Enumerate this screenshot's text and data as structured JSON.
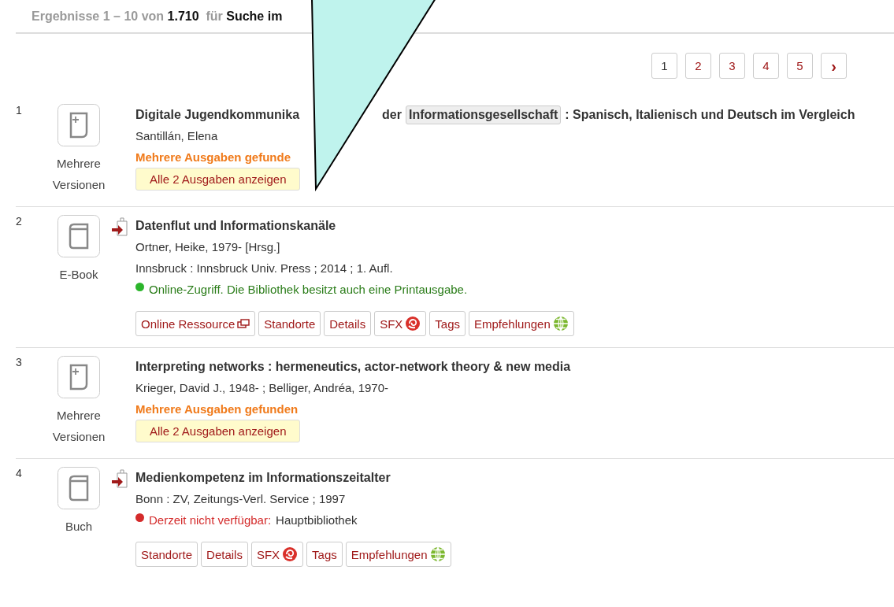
{
  "results_header": {
    "range": "Ergebnisse 1 – 10 von",
    "total": "1.710",
    "for": "für",
    "query": "Suche im"
  },
  "pagination": {
    "pages": [
      {
        "label": "1",
        "selected": true
      },
      {
        "label": "2",
        "selected": false
      },
      {
        "label": "3",
        "selected": false
      },
      {
        "label": "4",
        "selected": false
      },
      {
        "label": "5",
        "selected": false
      }
    ],
    "next": "›"
  },
  "results": [
    {
      "number": "1",
      "kind": "multi",
      "type_label": [
        "Mehrere",
        "Versionen"
      ],
      "access_icon": false,
      "title_parts": [
        {
          "text": "Digitale Jugendkommunika",
          "kind": "plain"
        },
        {
          "text": "der",
          "kind": "plain"
        },
        {
          "text": "Informationsgesellschaft",
          "kind": "highlight"
        },
        {
          "text": ": Spanisch, Italienisch und Deutsch im Vergleich",
          "kind": "plain"
        }
      ],
      "lines": [
        "Santillán, Elena"
      ],
      "editions_note": "Mehrere Ausgaben gefunde",
      "editions_button": "Alle 2 Ausgaben anzeigen"
    },
    {
      "number": "2",
      "kind": "book",
      "type_label": [
        "E-Book"
      ],
      "access_icon": true,
      "title_parts": [
        {
          "text": "Datenflut und Informationskanäle",
          "kind": "plain"
        }
      ],
      "lines": [
        "Ortner, Heike, 1979- [Hrsg.]",
        "Innsbruck : Innsbruck Univ. Press ; 2014 ; 1. Aufl."
      ],
      "status": {
        "kind": "online",
        "label": "Online-Zugriff. Die Bibliothek besitzt auch eine Printausgabe."
      },
      "actions": [
        {
          "label": "Online Ressource",
          "kind": "external"
        },
        {
          "label": "Standorte",
          "kind": "plain"
        },
        {
          "label": "Details",
          "kind": "plain"
        },
        {
          "label": "SFX",
          "kind": "sfx"
        },
        {
          "label": "Tags",
          "kind": "plain"
        },
        {
          "label": "Empfehlungen",
          "kind": "globe"
        }
      ]
    },
    {
      "number": "3",
      "kind": "multi",
      "type_label": [
        "Mehrere",
        "Versionen"
      ],
      "access_icon": false,
      "title_parts": [
        {
          "text": "Interpreting networks : hermeneutics, actor-network theory & new media",
          "kind": "plain"
        }
      ],
      "lines": [
        "Krieger, David J., 1948- ; Belliger, Andréa, 1970-"
      ],
      "editions_note": "Mehrere Ausgaben gefunden",
      "editions_button": "Alle 2 Ausgaben anzeigen"
    },
    {
      "number": "4",
      "kind": "book",
      "type_label": [
        "Buch"
      ],
      "access_icon": true,
      "title_parts": [
        {
          "text": "Medienkompetenz im Informationszeitalter",
          "kind": "plain"
        }
      ],
      "lines": [
        "Bonn : ZV, Zeitungs-Verl. Service ; 1997"
      ],
      "status": {
        "kind": "unavailable",
        "label": "Derzeit nicht verfügbar:",
        "location": "Hauptbibliothek"
      },
      "actions": [
        {
          "label": "Standorte",
          "kind": "plain"
        },
        {
          "label": "Details",
          "kind": "plain"
        },
        {
          "label": "SFX",
          "kind": "sfx"
        },
        {
          "label": "Tags",
          "kind": "plain"
        },
        {
          "label": "Empfehlungen",
          "kind": "globe"
        }
      ]
    }
  ]
}
